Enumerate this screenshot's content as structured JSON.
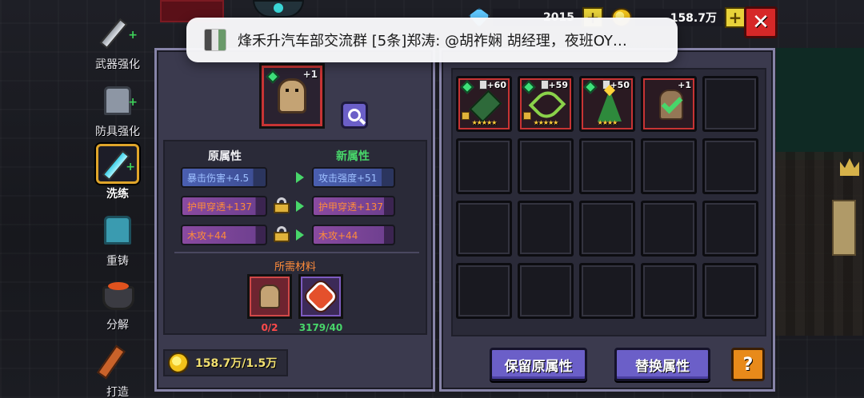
{
  "nav": {
    "items": [
      {
        "label": "武器强化",
        "icon": "sword-upgrade-icon"
      },
      {
        "label": "防具强化",
        "icon": "armor-upgrade-icon"
      },
      {
        "label": "洗练",
        "icon": "reforge-sword-icon",
        "active": true
      },
      {
        "label": "重铸",
        "icon": "recast-armor-icon"
      },
      {
        "label": "分解",
        "icon": "cauldron-icon"
      },
      {
        "label": "打造",
        "icon": "forge-hammer-icon"
      }
    ]
  },
  "notification": {
    "text": "烽禾升汽车部交流群 [5条]郑涛: @胡祚娴 胡经理，夜班OY…"
  },
  "currency": {
    "gems": "2015",
    "gold": "158.7万",
    "plus": "+"
  },
  "close_label": "✕",
  "selected_item": {
    "plus_level": "+1"
  },
  "attributes": {
    "original_header": "原属性",
    "new_header": "新属性",
    "rows": [
      {
        "original": "暴击伤害+4.5",
        "new": "攻击强度+51",
        "locked": false,
        "style": "blue"
      },
      {
        "original": "护甲穿透+137",
        "new": "护甲穿透+137",
        "locked": true,
        "style": "orange"
      },
      {
        "original": "木攻+44",
        "new": "木攻+44",
        "locked": true,
        "style": "orange"
      }
    ]
  },
  "materials": {
    "header": "所需材料",
    "items": [
      {
        "count": "0/2",
        "icon": "doll-material-icon",
        "status": "insufficient"
      },
      {
        "count": "3179/40",
        "icon": "reforge-stone-icon",
        "status": "sufficient"
      }
    ]
  },
  "gold_cost": "158.7万/1.5万",
  "inventory": {
    "slots": [
      {
        "upgrade": "+60",
        "stars": "★★★★★",
        "item": "green-dragon-spear",
        "locked": true
      },
      {
        "upgrade": "+59",
        "stars": "★★★★★",
        "item": "green-crossbow",
        "locked": true
      },
      {
        "upgrade": "+50",
        "stars": "★★★★",
        "item": "christmas-tree-staff",
        "locked": false
      },
      {
        "upgrade": "+1",
        "stars": "",
        "item": "selected-doll-armor",
        "locked": false,
        "selected": true
      }
    ],
    "total_slots": 20
  },
  "buttons": {
    "keep": "保留原属性",
    "replace": "替换属性",
    "help": "?"
  },
  "colors": {
    "accent_purple": "#6b5fc8",
    "active_orange": "#e0a52a",
    "new_attr_green": "#48d66a",
    "insufficient_red": "#ff4a4a",
    "close_red": "#d62828"
  }
}
